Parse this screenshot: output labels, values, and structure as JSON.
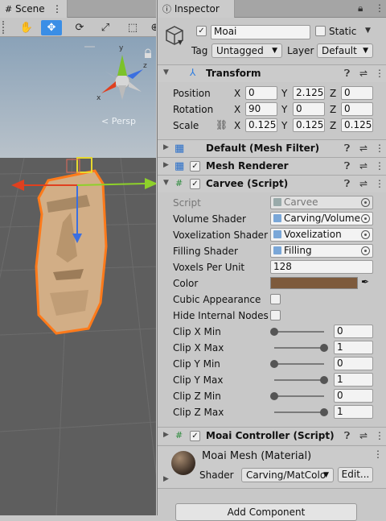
{
  "scene": {
    "tab_label": "Scene",
    "persp_label": "< Persp",
    "gizmo": {
      "x": "x",
      "y": "y",
      "z": "z"
    }
  },
  "inspector": {
    "tab_label": "Inspector",
    "object": {
      "name": "Moai",
      "static_label": "Static",
      "tag_label": "Tag",
      "tag_value": "Untagged",
      "layer_label": "Layer",
      "layer_value": "Default"
    },
    "transform": {
      "title": "Transform",
      "position_label": "Position",
      "rotation_label": "Rotation",
      "scale_label": "Scale",
      "axis_x": "X",
      "axis_y": "Y",
      "axis_z": "Z",
      "position": {
        "x": "0",
        "y": "2.125",
        "z": "0"
      },
      "rotation": {
        "x": "90",
        "y": "0",
        "z": "0"
      },
      "scale": {
        "x": "0.125",
        "y": "0.125",
        "z": "0.125"
      }
    },
    "mesh_filter": {
      "title": "Default (Mesh Filter)"
    },
    "mesh_renderer": {
      "title": "Mesh Renderer"
    },
    "carvee": {
      "title": "Carvee (Script)",
      "script_label": "Script",
      "script_value": "Carvee",
      "volume_shader_label": "Volume Shader",
      "volume_shader_value": "Carving/Volume",
      "voxelization_shader_label": "Voxelization Shader",
      "voxelization_shader_value": "Voxelization",
      "filling_shader_label": "Filling Shader",
      "filling_shader_value": "Filling",
      "voxels_per_unit_label": "Voxels Per Unit",
      "voxels_per_unit_value": "128",
      "color_label": "Color",
      "color_value": "#7d5a3c",
      "cubic_label": "Cubic Appearance",
      "hide_nodes_label": "Hide Internal Nodes",
      "clips": [
        {
          "label": "Clip X Min",
          "value": "0",
          "fraction": 0
        },
        {
          "label": "Clip X Max",
          "value": "1",
          "fraction": 1
        },
        {
          "label": "Clip Y Min",
          "value": "0",
          "fraction": 0
        },
        {
          "label": "Clip Y Max",
          "value": "1",
          "fraction": 1
        },
        {
          "label": "Clip Z Min",
          "value": "0",
          "fraction": 0
        },
        {
          "label": "Clip Z Max",
          "value": "1",
          "fraction": 1
        }
      ]
    },
    "moai_controller": {
      "title": "Moai Controller (Script)"
    },
    "material": {
      "name": "Moai Mesh (Material)",
      "shader_label": "Shader",
      "shader_value": "Carving/MatColo",
      "edit_label": "Edit..."
    },
    "add_component_label": "Add Component"
  }
}
